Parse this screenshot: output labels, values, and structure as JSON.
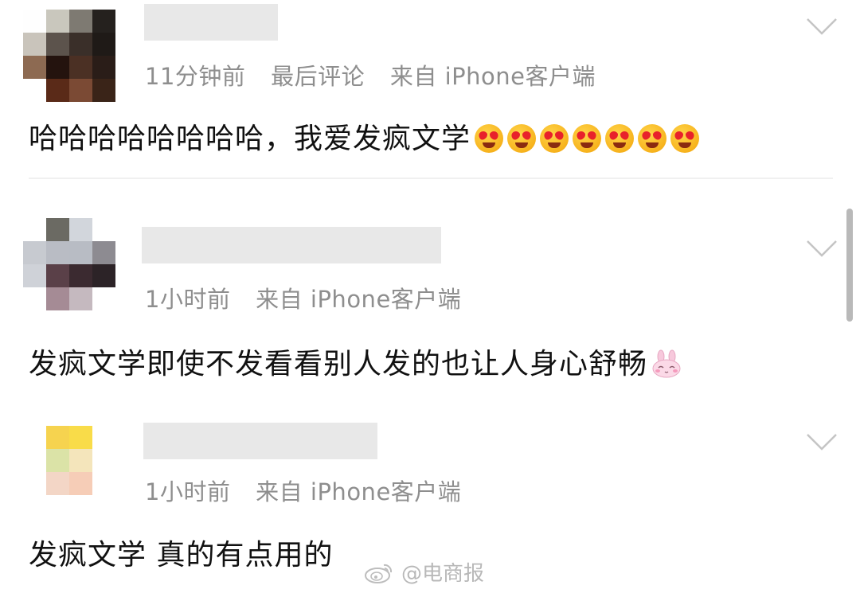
{
  "comments": [
    {
      "time": "11分钟前",
      "tag": "最后评论",
      "source": "来自 iPhone客户端",
      "text": "哈哈哈哈哈哈哈哈，我爱发疯文学",
      "emoji": "heart-eyes-emoji",
      "emoji_count": 7
    },
    {
      "time": "1小时前",
      "source": "来自 iPhone客户端",
      "text": "发疯文学即使不发看看别人发的也让人身心舒畅",
      "emoji": "bunny-emoji"
    },
    {
      "time": "1小时前",
      "source": "来自 iPhone客户端",
      "text": "发疯文学 真的有点用的"
    }
  ],
  "watermark": "@电商报",
  "icons": [
    "chevron-down-icon",
    "weibo-logo-icon"
  ],
  "colors": {
    "meta_text": "#8e8e8e",
    "name_placeholder": "#e8e8e8",
    "watermark": "#b8b8b8"
  }
}
